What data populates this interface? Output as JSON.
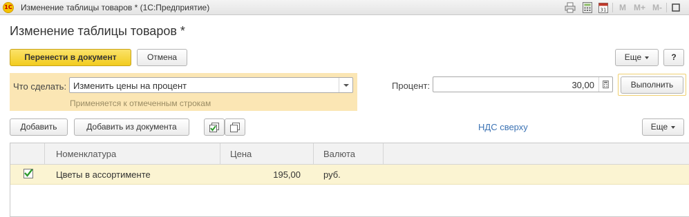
{
  "window": {
    "title": "Изменение таблицы товаров * (1С:Предприятие)",
    "logo_text": "1С",
    "memory_buttons": [
      "M",
      "M+",
      "M-"
    ]
  },
  "form": {
    "heading": "Изменение таблицы товаров *"
  },
  "toolbar": {
    "transfer_label": "Перенести в документ",
    "cancel_label": "Отмена",
    "more_label": "Еще",
    "help_label": "?"
  },
  "action": {
    "what_label": "Что сделать:",
    "what_value": "Изменить цены на процент",
    "hint": "Применяется к отмеченным строкам",
    "percent_label": "Процент:",
    "percent_value": "30,00",
    "execute_label": "Выполнить"
  },
  "table_toolbar": {
    "add_label": "Добавить",
    "add_from_doc_label": "Добавить из документа",
    "vat_link": "НДС сверху",
    "more_label": "Еще"
  },
  "table": {
    "columns": [
      "Номенклатура",
      "Цена",
      "Валюта"
    ],
    "rows": [
      {
        "checked": true,
        "item": "Цветы в ассортименте",
        "price": "195,00",
        "currency": "руб."
      }
    ]
  },
  "colors": {
    "accent_yellow": "#f2cc1e",
    "panel_bg": "#fbe6b4",
    "row_selected": "#fbf4d2",
    "link": "#3c73b4",
    "check_green": "#2e9a2e"
  }
}
